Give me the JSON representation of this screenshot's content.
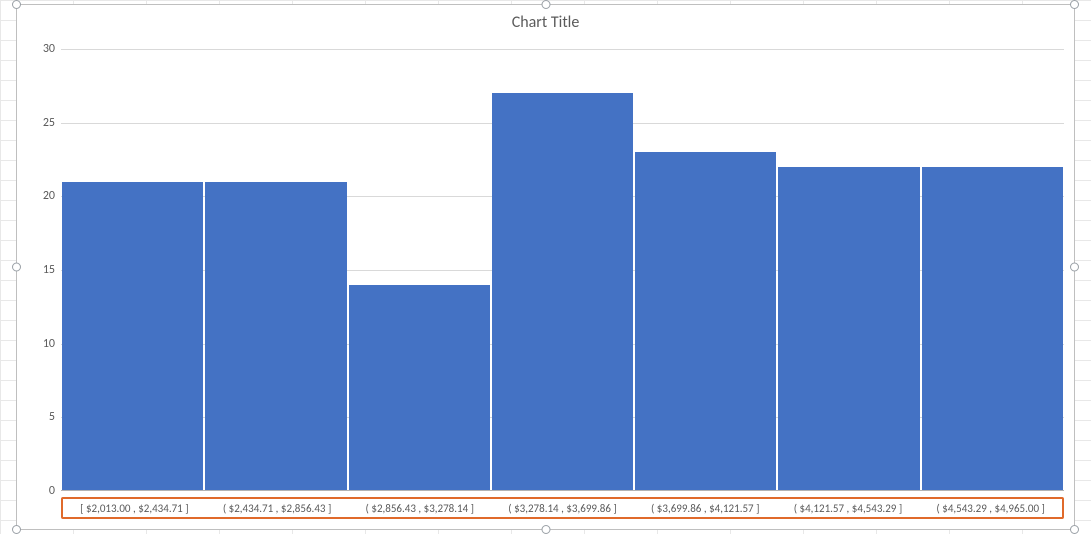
{
  "chart_data": {
    "type": "bar",
    "title": "Chart Title",
    "categories": [
      "[ $2,013.00 ,  $2,434.71 ]",
      "( $2,434.71 ,  $2,856.43 ]",
      "( $2,856.43 ,  $3,278.14 ]",
      "( $3,278.14 ,  $3,699.86 ]",
      "( $3,699.86 ,  $4,121.57 ]",
      "( $4,121.57 ,  $4,543.29 ]",
      "( $4,543.29 ,  $4,965.00 ]"
    ],
    "values": [
      21,
      21,
      14,
      27,
      23,
      22,
      22
    ],
    "xlabel": "",
    "ylabel": "",
    "ylim": [
      0,
      30
    ],
    "y_ticks": [
      0,
      5,
      10,
      15,
      20,
      25,
      30
    ]
  }
}
